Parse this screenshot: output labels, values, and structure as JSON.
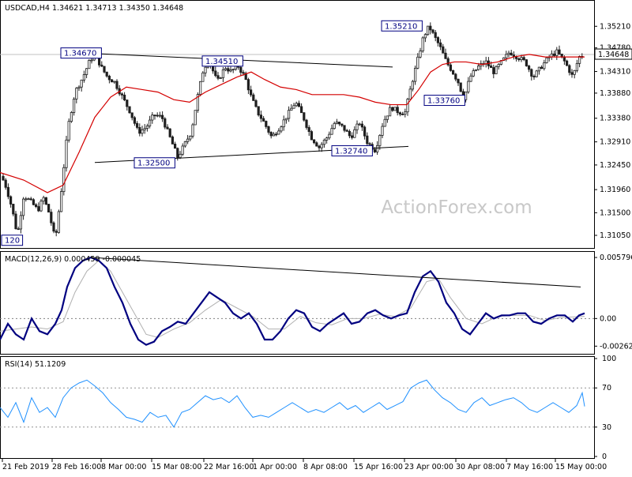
{
  "colors": {
    "candle": "#1f1f1f",
    "sma": "#d40000",
    "macd_main": "#000080",
    "macd_signal": "#b0b0b0",
    "rsi": "#1e90ff",
    "trendline": "#000000",
    "grid": "#dddddd",
    "watermark": "#c8c8c8",
    "label_border": "#000080"
  },
  "main_panel": {
    "header": "USDCAD,H4  1.34621 1.34713 1.34350 1.34648",
    "watermark": "ActionForex.com",
    "y_ticks": [
      "1.35210",
      "1.34780",
      "1.34310",
      "1.33880",
      "1.33380",
      "1.32910",
      "1.32450",
      "1.31960",
      "1.31500",
      "1.31050"
    ],
    "current_price": "1.34648",
    "annotations": [
      "1.34670",
      "1.34510",
      "1.35210",
      "1.33760",
      "1.32500",
      "1.32740",
      "120"
    ]
  },
  "macd_panel": {
    "header": "MACD(12,26,9) 0.000459 -0.000045",
    "y_ticks": [
      "0.005796",
      "0.00",
      "-0.002623"
    ]
  },
  "rsi_panel": {
    "header": "RSI(14) 51.1209",
    "y_ticks": [
      "100",
      "70",
      "30",
      "0"
    ]
  },
  "x_axis": {
    "labels": [
      "21 Feb 2019",
      "28 Feb 16:00",
      "8 Mar 00:00",
      "15 Mar 08:00",
      "22 Mar 16:00",
      "1 Apr 00:00",
      "8 Apr 08:00",
      "15 Apr 16:00",
      "23 Apr 00:00",
      "30 Apr 08:00",
      "7 May 16:00",
      "15 May 00:00"
    ]
  },
  "chart_data": {
    "type": "candlestick",
    "symbol": "USDCAD",
    "timeframe": "H4",
    "ohlc_last": {
      "open": 1.34621,
      "high": 1.34713,
      "low": 1.3435,
      "close": 1.34648
    },
    "ylim": [
      1.3083,
      1.3545
    ],
    "x_categories": [
      "21 Feb 2019",
      "28 Feb 16:00",
      "8 Mar 00:00",
      "15 Mar 08:00",
      "22 Mar 16:00",
      "1 Apr 00:00",
      "8 Apr 08:00",
      "15 Apr 16:00",
      "23 Apr 00:00",
      "30 Apr 08:00",
      "7 May 16:00",
      "15 May 00:00"
    ],
    "close_path": [
      [
        0,
        1.323
      ],
      [
        8,
        1.32
      ],
      [
        15,
        1.316
      ],
      [
        22,
        1.3105
      ],
      [
        30,
        1.3185
      ],
      [
        40,
        1.317
      ],
      [
        48,
        1.3155
      ],
      [
        55,
        1.318
      ],
      [
        62,
        1.315
      ],
      [
        70,
        1.3095
      ],
      [
        78,
        1.32
      ],
      [
        86,
        1.332
      ],
      [
        95,
        1.339
      ],
      [
        105,
        1.342
      ],
      [
        113,
        1.345
      ],
      [
        120,
        1.3467
      ],
      [
        128,
        1.344
      ],
      [
        136,
        1.342
      ],
      [
        145,
        1.341
      ],
      [
        155,
        1.338
      ],
      [
        165,
        1.335
      ],
      [
        175,
        1.331
      ],
      [
        185,
        1.332
      ],
      [
        195,
        1.3345
      ],
      [
        205,
        1.334
      ],
      [
        215,
        1.33
      ],
      [
        225,
        1.326
      ],
      [
        235,
        1.329
      ],
      [
        242,
        1.331
      ],
      [
        250,
        1.338
      ],
      [
        258,
        1.344
      ],
      [
        265,
        1.3451
      ],
      [
        275,
        1.341
      ],
      [
        285,
        1.344
      ],
      [
        293,
        1.343
      ],
      [
        300,
        1.3445
      ],
      [
        310,
        1.342
      ],
      [
        318,
        1.338
      ],
      [
        326,
        1.335
      ],
      [
        334,
        1.333
      ],
      [
        344,
        1.33
      ],
      [
        354,
        1.332
      ],
      [
        364,
        1.3345
      ],
      [
        374,
        1.337
      ],
      [
        384,
        1.334
      ],
      [
        394,
        1.33
      ],
      [
        404,
        1.328
      ],
      [
        414,
        1.33
      ],
      [
        424,
        1.333
      ],
      [
        434,
        1.332
      ],
      [
        444,
        1.33
      ],
      [
        455,
        1.333
      ],
      [
        465,
        1.329
      ],
      [
        475,
        1.3274
      ],
      [
        485,
        1.333
      ],
      [
        495,
        1.336
      ],
      [
        505,
        1.335
      ],
      [
        513,
        1.335
      ],
      [
        520,
        1.34
      ],
      [
        528,
        1.345
      ],
      [
        536,
        1.35
      ],
      [
        543,
        1.3521
      ],
      [
        550,
        1.35
      ],
      [
        557,
        1.348
      ],
      [
        565,
        1.345
      ],
      [
        573,
        1.343
      ],
      [
        580,
        1.341
      ],
      [
        587,
        1.3376
      ],
      [
        595,
        1.342
      ],
      [
        605,
        1.344
      ],
      [
        615,
        1.345
      ],
      [
        625,
        1.343
      ],
      [
        635,
        1.345
      ],
      [
        645,
        1.347
      ],
      [
        655,
        1.346
      ],
      [
        665,
        1.345
      ],
      [
        675,
        1.342
      ],
      [
        685,
        1.344
      ],
      [
        695,
        1.346
      ],
      [
        705,
        1.347
      ],
      [
        715,
        1.345
      ],
      [
        725,
        1.342
      ],
      [
        733,
        1.346
      ],
      [
        740,
        1.34648
      ]
    ],
    "sma_path": [
      [
        0,
        1.323
      ],
      [
        30,
        1.3215
      ],
      [
        60,
        1.319
      ],
      [
        80,
        1.3205
      ],
      [
        100,
        1.327
      ],
      [
        120,
        1.334
      ],
      [
        140,
        1.338
      ],
      [
        160,
        1.34
      ],
      [
        180,
        1.3395
      ],
      [
        200,
        1.339
      ],
      [
        220,
        1.3375
      ],
      [
        240,
        1.337
      ],
      [
        260,
        1.339
      ],
      [
        280,
        1.3405
      ],
      [
        300,
        1.342
      ],
      [
        318,
        1.343
      ],
      [
        335,
        1.3415
      ],
      [
        355,
        1.34
      ],
      [
        375,
        1.3395
      ],
      [
        395,
        1.3385
      ],
      [
        415,
        1.3385
      ],
      [
        435,
        1.3385
      ],
      [
        455,
        1.338
      ],
      [
        475,
        1.337
      ],
      [
        495,
        1.3365
      ],
      [
        515,
        1.3365
      ],
      [
        530,
        1.3395
      ],
      [
        545,
        1.343
      ],
      [
        560,
        1.3445
      ],
      [
        575,
        1.345
      ],
      [
        590,
        1.345
      ],
      [
        610,
        1.3445
      ],
      [
        630,
        1.345
      ],
      [
        650,
        1.346
      ],
      [
        670,
        1.3465
      ],
      [
        690,
        1.346
      ],
      [
        710,
        1.346
      ],
      [
        740,
        1.346
      ]
    ],
    "trendlines": [
      {
        "from": [
          115,
          1.3467
        ],
        "to": [
          497,
          1.344
        ]
      },
      {
        "from": [
          120,
          1.325
        ],
        "to": [
          517,
          1.3282
        ]
      }
    ],
    "macd": {
      "ylim": [
        -0.0032,
        0.0061
      ],
      "main": [
        [
          0,
          -0.002
        ],
        [
          10,
          -0.0005
        ],
        [
          20,
          -0.0015
        ],
        [
          30,
          -0.002
        ],
        [
          40,
          0.0
        ],
        [
          50,
          -0.0012
        ],
        [
          60,
          -0.0015
        ],
        [
          70,
          -0.0005
        ],
        [
          78,
          0.0008
        ],
        [
          85,
          0.003
        ],
        [
          95,
          0.0048
        ],
        [
          105,
          0.0055
        ],
        [
          115,
          0.0058
        ],
        [
          125,
          0.0055
        ],
        [
          135,
          0.0048
        ],
        [
          145,
          0.003
        ],
        [
          155,
          0.0015
        ],
        [
          165,
          -0.0005
        ],
        [
          175,
          -0.002
        ],
        [
          185,
          -0.0025
        ],
        [
          195,
          -0.0022
        ],
        [
          205,
          -0.0012
        ],
        [
          215,
          -0.0008
        ],
        [
          225,
          -0.0003
        ],
        [
          235,
          -0.0005
        ],
        [
          245,
          0.0005
        ],
        [
          255,
          0.0015
        ],
        [
          265,
          0.0025
        ],
        [
          275,
          0.002
        ],
        [
          285,
          0.0015
        ],
        [
          295,
          0.0005
        ],
        [
          305,
          0.0
        ],
        [
          315,
          0.0005
        ],
        [
          325,
          -0.0005
        ],
        [
          335,
          -0.002
        ],
        [
          345,
          -0.002
        ],
        [
          355,
          -0.0012
        ],
        [
          365,
          0.0
        ],
        [
          375,
          0.0008
        ],
        [
          385,
          0.0005
        ],
        [
          395,
          -0.0008
        ],
        [
          405,
          -0.0012
        ],
        [
          415,
          -0.0005
        ],
        [
          425,
          0.0
        ],
        [
          435,
          0.0005
        ],
        [
          445,
          -0.0005
        ],
        [
          455,
          -0.0003
        ],
        [
          465,
          0.0005
        ],
        [
          475,
          0.0008
        ],
        [
          485,
          0.0003
        ],
        [
          495,
          0.0
        ],
        [
          505,
          0.0003
        ],
        [
          515,
          0.0005
        ],
        [
          525,
          0.0025
        ],
        [
          535,
          0.004
        ],
        [
          545,
          0.0045
        ],
        [
          555,
          0.0035
        ],
        [
          565,
          0.0015
        ],
        [
          575,
          0.0005
        ],
        [
          585,
          -0.001
        ],
        [
          595,
          -0.0015
        ],
        [
          605,
          -0.0005
        ],
        [
          615,
          0.0005
        ],
        [
          625,
          0.0
        ],
        [
          635,
          0.0003
        ],
        [
          645,
          0.0003
        ],
        [
          655,
          0.0005
        ],
        [
          665,
          0.0005
        ],
        [
          675,
          -0.0003
        ],
        [
          685,
          -0.0005
        ],
        [
          695,
          0.0
        ],
        [
          705,
          0.0003
        ],
        [
          715,
          0.0003
        ],
        [
          725,
          -0.0003
        ],
        [
          733,
          0.0003
        ],
        [
          740,
          0.0005
        ]
      ],
      "signal": [
        [
          0,
          -0.0012
        ],
        [
          20,
          -0.001
        ],
        [
          40,
          -0.0008
        ],
        [
          60,
          -0.001
        ],
        [
          80,
          -0.0003
        ],
        [
          95,
          0.0025
        ],
        [
          110,
          0.0045
        ],
        [
          125,
          0.0055
        ],
        [
          140,
          0.0045
        ],
        [
          155,
          0.0025
        ],
        [
          170,
          0.0005
        ],
        [
          185,
          -0.0015
        ],
        [
          200,
          -0.0018
        ],
        [
          220,
          -0.001
        ],
        [
          240,
          -0.0004
        ],
        [
          260,
          0.0008
        ],
        [
          280,
          0.0018
        ],
        [
          300,
          0.001
        ],
        [
          320,
          0.0002
        ],
        [
          340,
          -0.001
        ],
        [
          360,
          -0.001
        ],
        [
          380,
          0.0002
        ],
        [
          400,
          -0.0004
        ],
        [
          420,
          -0.0006
        ],
        [
          440,
          0.0
        ],
        [
          460,
          0.0
        ],
        [
          480,
          0.0004
        ],
        [
          500,
          0.0002
        ],
        [
          520,
          0.001
        ],
        [
          540,
          0.0035
        ],
        [
          555,
          0.0038
        ],
        [
          570,
          0.002
        ],
        [
          590,
          0.0
        ],
        [
          610,
          -0.0005
        ],
        [
          630,
          0.0002
        ],
        [
          650,
          0.0003
        ],
        [
          670,
          0.0003
        ],
        [
          690,
          -0.0002
        ],
        [
          710,
          0.0001
        ],
        [
          740,
          0.0002
        ]
      ],
      "trendline": {
        "from": [
          115,
          0.0058
        ],
        "to": [
          735,
          0.003
        ]
      }
    },
    "rsi": {
      "ylim": [
        0,
        100
      ],
      "levels": [
        70,
        30
      ],
      "path": [
        [
          0,
          50
        ],
        [
          10,
          40
        ],
        [
          20,
          55
        ],
        [
          30,
          35
        ],
        [
          40,
          60
        ],
        [
          50,
          45
        ],
        [
          60,
          50
        ],
        [
          70,
          40
        ],
        [
          80,
          60
        ],
        [
          90,
          70
        ],
        [
          100,
          75
        ],
        [
          110,
          78
        ],
        [
          120,
          72
        ],
        [
          130,
          65
        ],
        [
          140,
          55
        ],
        [
          150,
          48
        ],
        [
          160,
          40
        ],
        [
          170,
          38
        ],
        [
          180,
          35
        ],
        [
          190,
          45
        ],
        [
          200,
          40
        ],
        [
          210,
          42
        ],
        [
          220,
          30
        ],
        [
          230,
          45
        ],
        [
          240,
          48
        ],
        [
          250,
          55
        ],
        [
          260,
          62
        ],
        [
          270,
          58
        ],
        [
          280,
          60
        ],
        [
          290,
          55
        ],
        [
          300,
          62
        ],
        [
          310,
          50
        ],
        [
          320,
          40
        ],
        [
          330,
          42
        ],
        [
          340,
          40
        ],
        [
          350,
          45
        ],
        [
          360,
          50
        ],
        [
          370,
          55
        ],
        [
          380,
          50
        ],
        [
          390,
          45
        ],
        [
          400,
          48
        ],
        [
          410,
          45
        ],
        [
          420,
          50
        ],
        [
          430,
          55
        ],
        [
          440,
          48
        ],
        [
          450,
          52
        ],
        [
          460,
          45
        ],
        [
          470,
          50
        ],
        [
          480,
          55
        ],
        [
          490,
          48
        ],
        [
          500,
          52
        ],
        [
          510,
          56
        ],
        [
          520,
          70
        ],
        [
          530,
          75
        ],
        [
          540,
          78
        ],
        [
          550,
          68
        ],
        [
          560,
          60
        ],
        [
          570,
          55
        ],
        [
          580,
          48
        ],
        [
          590,
          45
        ],
        [
          600,
          55
        ],
        [
          610,
          60
        ],
        [
          620,
          52
        ],
        [
          630,
          55
        ],
        [
          640,
          58
        ],
        [
          650,
          60
        ],
        [
          660,
          55
        ],
        [
          670,
          48
        ],
        [
          680,
          45
        ],
        [
          690,
          50
        ],
        [
          700,
          55
        ],
        [
          710,
          50
        ],
        [
          720,
          45
        ],
        [
          730,
          52
        ],
        [
          737,
          65
        ],
        [
          740,
          51.12
        ]
      ]
    }
  }
}
